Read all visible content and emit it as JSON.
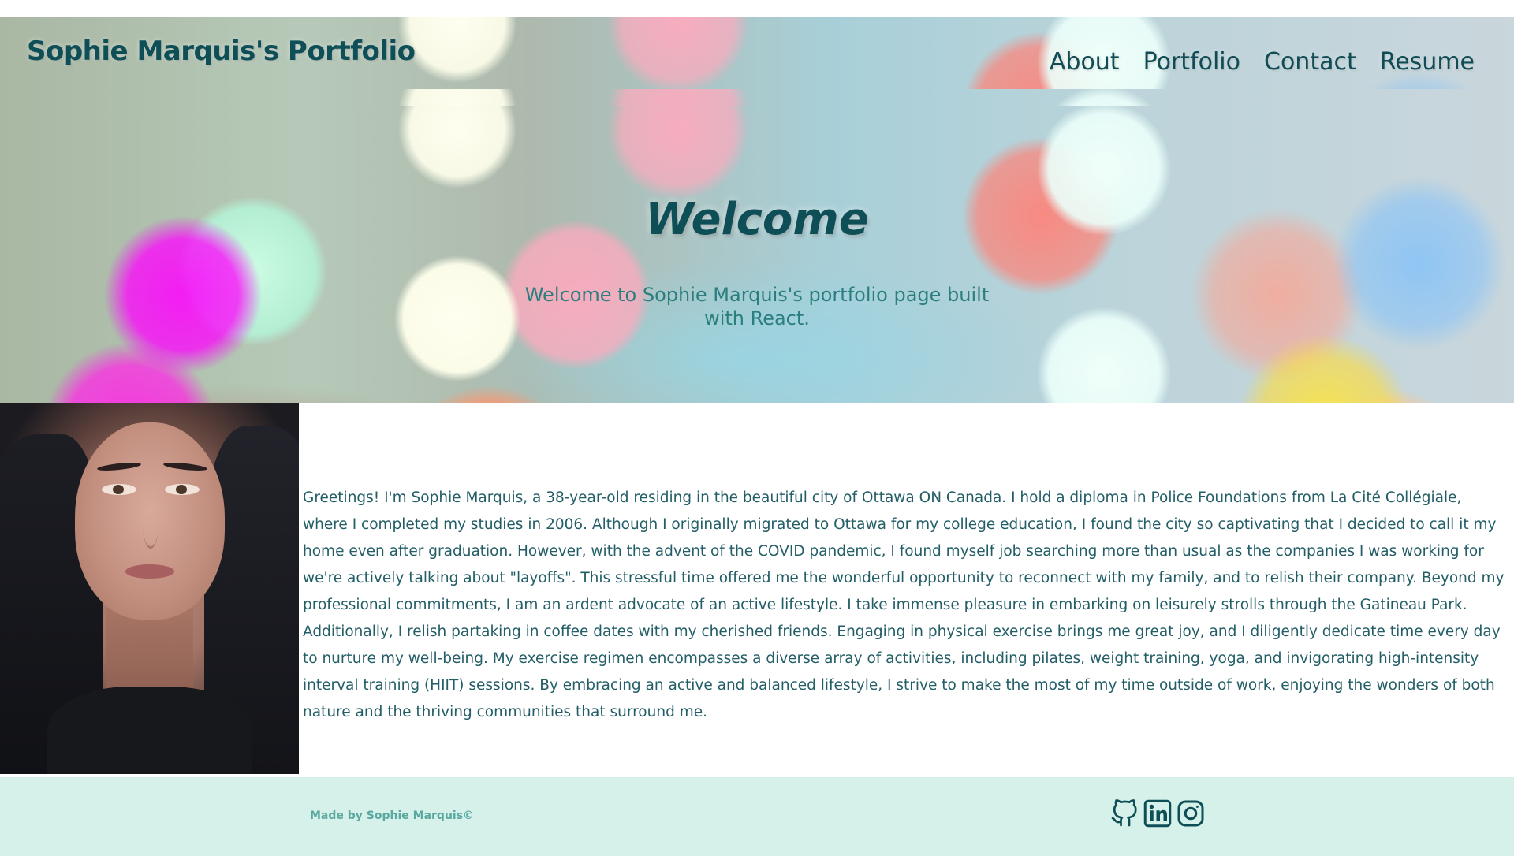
{
  "header": {
    "site_title": "Sophie Marquis's Portfolio",
    "nav": [
      {
        "label": "About"
      },
      {
        "label": "Portfolio"
      },
      {
        "label": "Contact"
      },
      {
        "label": "Resume"
      }
    ]
  },
  "hero": {
    "heading": "Welcome",
    "subheading": "Welcome to Sophie Marquis's portfolio page built with React."
  },
  "about": {
    "bio": "Greetings! I'm Sophie Marquis, a 38-year-old residing in the beautiful city of Ottawa ON Canada. I hold a diploma in Police Foundations from La Cité Collégiale, where I completed my studies in 2006. Although I originally migrated to Ottawa for my college education, I found the city so captivating that I decided to call it my home even after graduation. However, with the advent of the COVID pandemic, I found myself job searching more than usual as the companies I was working for we're actively talking about \"layoffs\". This stressful time offered me the wonderful opportunity to reconnect with my family, and to relish their company. Beyond my professional commitments, I am an ardent advocate of an active lifestyle. I take immense pleasure in embarking on leisurely strolls through the Gatineau Park. Additionally, I relish partaking in coffee dates with my cherished friends. Engaging in physical exercise brings me great joy, and I diligently dedicate time every day to nurture my well-being. My exercise regimen encompasses a diverse array of activities, including pilates, weight training, yoga, and invigorating high-intensity interval training (HIIT) sessions. By embracing an active and balanced lifestyle, I strive to make the most of my time outside of work, enjoying the wonders of both nature and the thriving communities that surround me."
  },
  "footer": {
    "credit": "Made by Sophie Marquis©",
    "socials": [
      {
        "icon": "github-icon"
      },
      {
        "icon": "linkedin-icon"
      },
      {
        "icon": "instagram-icon"
      }
    ]
  },
  "colors": {
    "primary_text": "#0e4f57",
    "subheading_text": "#2a7e7e",
    "body_text": "#235e66",
    "footer_bg": "#d6f0ea",
    "footer_text": "#5aa9a0"
  }
}
